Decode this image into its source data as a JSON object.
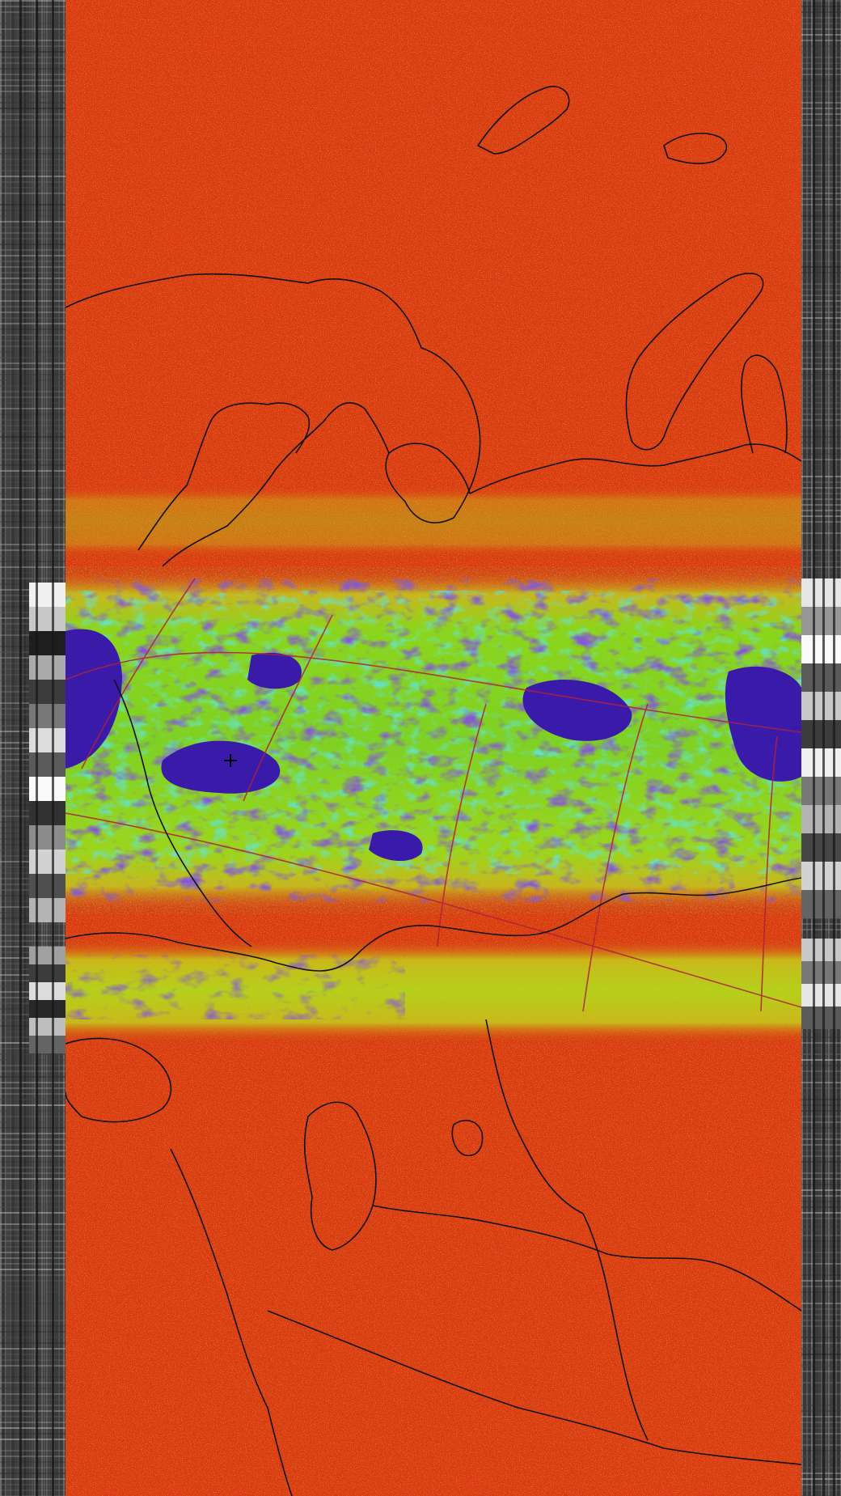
{
  "image": {
    "kind": "NOAA APT false-color satellite image",
    "colors": {
      "background_red": "#d83a12",
      "noise_orange": "#f5a010",
      "noise_yellow": "#d8d820",
      "cloud_green": "#8dd418",
      "cloud_cyan": "#20c8b8",
      "cloud_blue": "#3a1aa8",
      "coastline": "#111111",
      "graticule": "#b0203a",
      "telemetry_gray": "#7a7a7a"
    },
    "icons": [
      "city-cross-icon"
    ]
  }
}
